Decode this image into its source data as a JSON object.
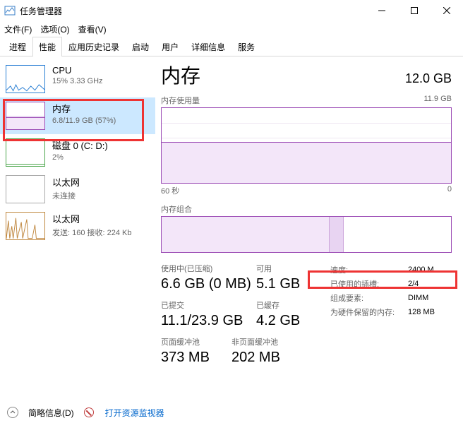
{
  "window": {
    "title": "任务管理器",
    "menu": {
      "file": "文件(F)",
      "options": "选项(O)",
      "view": "查看(V)"
    },
    "tabs": [
      "进程",
      "性能",
      "应用历史记录",
      "启动",
      "用户",
      "详细信息",
      "服务"
    ],
    "active_tab_index": 1
  },
  "sidebar": {
    "items": [
      {
        "title": "CPU",
        "sub": "15% 3.33 GHz"
      },
      {
        "title": "内存",
        "sub": "6.8/11.9 GB (57%)"
      },
      {
        "title": "磁盘 0 (C: D:)",
        "sub": "2%"
      },
      {
        "title": "以太网",
        "sub": "未连接"
      },
      {
        "title": "以太网",
        "sub": "发送: 160 接收: 224 Kb"
      }
    ],
    "selected_index": 1
  },
  "main": {
    "title": "内存",
    "capacity": "12.0 GB",
    "usage_graph": {
      "label": "内存使用量",
      "max_label": "11.9 GB",
      "x_left": "60 秒",
      "x_right": "0"
    },
    "composition": {
      "label": "内存组合"
    },
    "stats": {
      "in_use": {
        "label": "使用中(已压缩)",
        "value": "6.6 GB (0 MB)"
      },
      "available": {
        "label": "可用",
        "value": "5.1 GB"
      },
      "committed": {
        "label": "已提交",
        "value": "11.1/23.9 GB"
      },
      "cached": {
        "label": "已缓存",
        "value": "4.2 GB"
      },
      "paged_pool": {
        "label": "页面缓冲池",
        "value": "373 MB"
      },
      "nonpaged_pool": {
        "label": "非页面缓冲池",
        "value": "202 MB"
      }
    },
    "info": {
      "speed": {
        "k": "速度:",
        "v": "2400 M..."
      },
      "slots": {
        "k": "已使用的插槽:",
        "v": "2/4"
      },
      "form": {
        "k": "组成要素:",
        "v": "DIMM"
      },
      "reserved": {
        "k": "为硬件保留的内存:",
        "v": "128 MB"
      }
    }
  },
  "footer": {
    "less_details": "简略信息(D)",
    "open_monitor": "打开资源监视器"
  }
}
